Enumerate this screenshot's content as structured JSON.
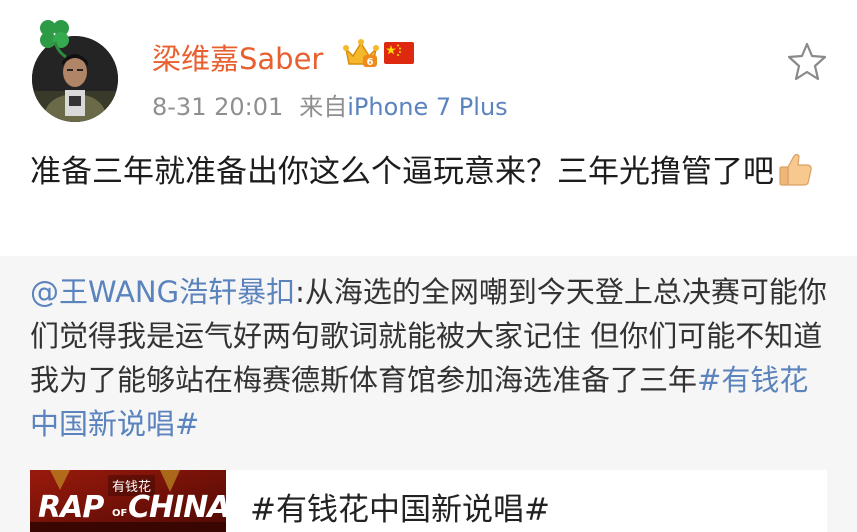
{
  "post": {
    "author": "梁维嘉Saber",
    "time": "8-31 20:01",
    "source_prefix": "来自",
    "device": "iPhone 7 Plus",
    "text_main": "准备三年就准备出你这么个逼玩意来？三年光撸管了吧"
  },
  "icons": {
    "avatar": "avatar",
    "clover": "clover-icon",
    "crown": "vip-crown-icon",
    "flag": "china-flag-icon",
    "star": "favorite-star-icon",
    "thumb": "thumbs-up-emoji"
  },
  "repost": {
    "mention": "@王WANG浩轩暴扣",
    "separator": ":",
    "body": "从海选的全网嘲到今天登上总决赛可能你们觉得我是运气好两句歌词就能被大家记住 但你们可能不知道我为了能够站在梅赛德斯体育馆参加海选准备了三年",
    "hashtag": "#有钱花中国新说唱#"
  },
  "card": {
    "title": "#有钱花中国新说唱#",
    "thumb_badge": "有钱花",
    "thumb_logo_top": "RAP",
    "thumb_logo_of": "OF",
    "thumb_logo_bottom": "CHINA"
  },
  "colors": {
    "author_orange": "#e8602f",
    "link_blue": "#5b83bd",
    "meta_gray": "#8f8f8f",
    "repost_bg": "#f6f6f6"
  }
}
